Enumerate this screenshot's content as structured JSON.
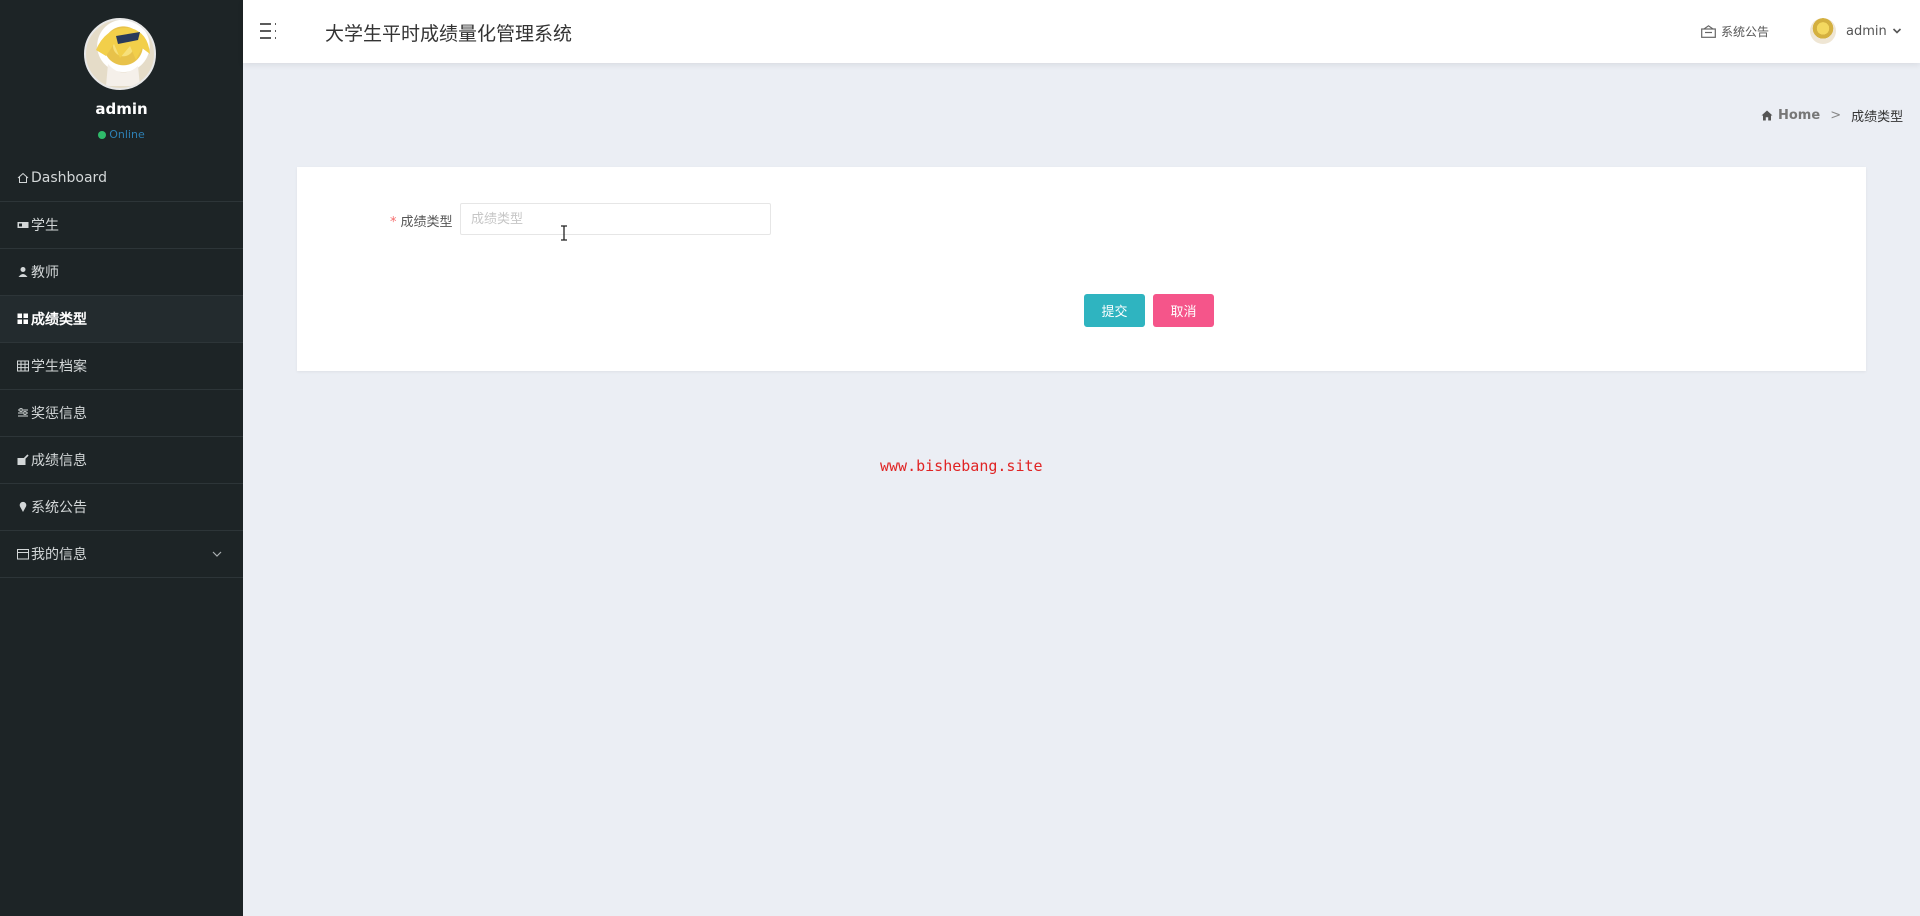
{
  "sidebar": {
    "profile": {
      "name": "admin",
      "status": "Online"
    },
    "items": [
      {
        "label": "Dashboard",
        "icon": "home-icon"
      },
      {
        "label": "学生",
        "icon": "id-card-icon"
      },
      {
        "label": "教师",
        "icon": "user-icon"
      },
      {
        "label": "成绩类型",
        "icon": "grid-icon",
        "active": true
      },
      {
        "label": "学生档案",
        "icon": "table-icon"
      },
      {
        "label": "奖惩信息",
        "icon": "sliders-icon"
      },
      {
        "label": "成绩信息",
        "icon": "edit-icon"
      },
      {
        "label": "系统公告",
        "icon": "pin-icon"
      },
      {
        "label": "我的信息",
        "icon": "calendar-icon",
        "has_submenu": true
      }
    ]
  },
  "header": {
    "title": "大学生平时成绩量化管理系统",
    "notice": "系统公告",
    "user": "admin"
  },
  "breadcrumb": {
    "home": "Home",
    "separator": ">",
    "current": "成绩类型"
  },
  "form": {
    "field_label": "成绩类型",
    "required_mark": "*",
    "field_value": "",
    "field_placeholder": "成绩类型",
    "submit_label": "提交",
    "cancel_label": "取消"
  },
  "watermark": "www.bishebang.site",
  "colors": {
    "sidebar_bg": "#1d2426",
    "page_bg": "#ebeef4",
    "submit": "#2fb4c0",
    "cancel": "#f5558a",
    "status_dot": "#2fba6a",
    "watermark": "#e02424"
  }
}
